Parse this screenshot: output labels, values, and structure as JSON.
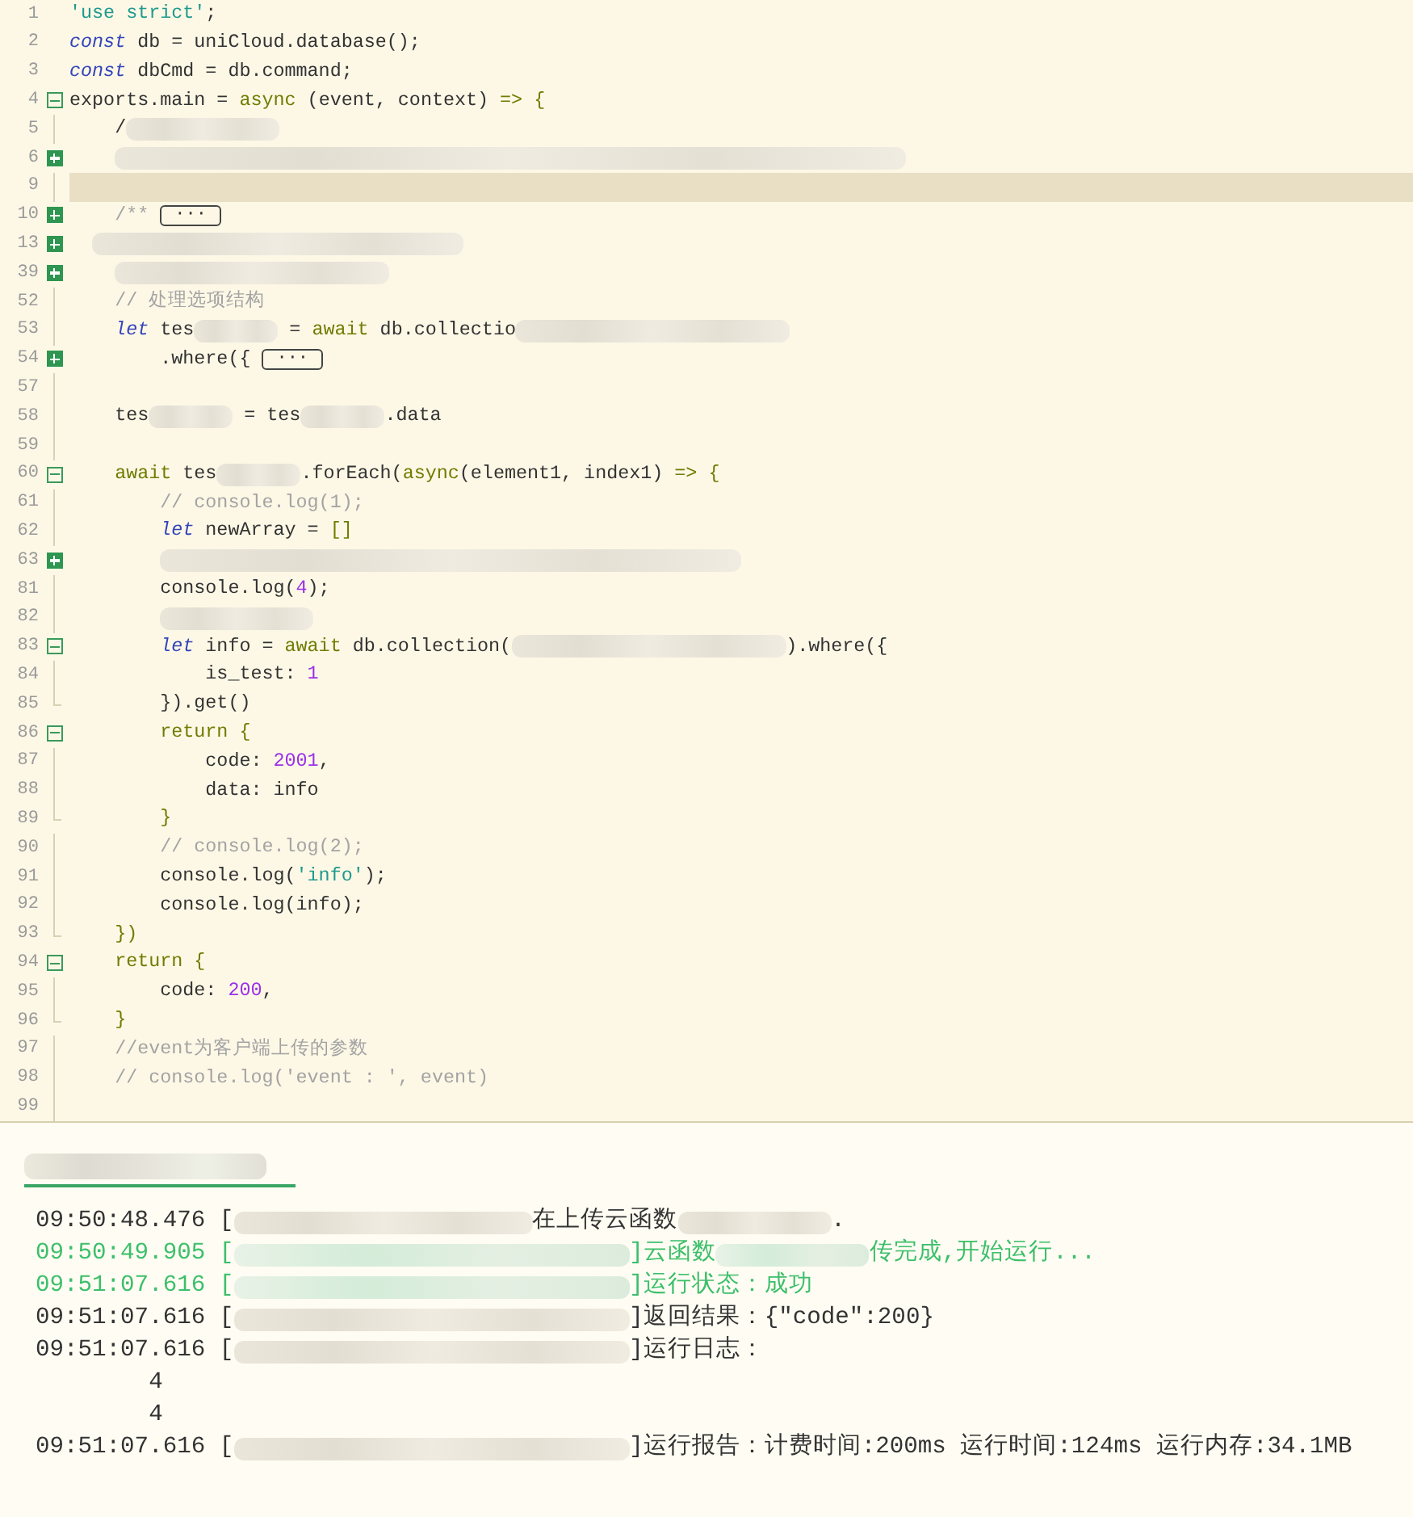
{
  "editor": {
    "lines": [
      {
        "num": "1",
        "kind": "plain",
        "highlighted": false,
        "tokens": [
          {
            "kind": "string",
            "s": "'use strict'"
          },
          {
            "kind": "plain",
            "s": ";"
          }
        ]
      },
      {
        "num": "2",
        "kind": "plain",
        "highlighted": false,
        "tokens": [
          {
            "kind": "keyword",
            "s": "const"
          },
          {
            "kind": "plain",
            "s": " db = uniCloud.database();"
          }
        ]
      },
      {
        "num": "3",
        "kind": "plain",
        "highlighted": false,
        "tokens": [
          {
            "kind": "keyword",
            "s": "const"
          },
          {
            "kind": "plain",
            "s": " dbCmd = db.command;"
          }
        ]
      },
      {
        "num": "4",
        "kind": "open",
        "highlighted": false,
        "tokens": [
          {
            "kind": "plain",
            "s": "exports.main = "
          },
          {
            "kind": "olive",
            "s": "async"
          },
          {
            "kind": "plain",
            "s": " (event, context) "
          },
          {
            "kind": "olive",
            "s": "=> {"
          }
        ]
      },
      {
        "num": "5",
        "kind": "body",
        "highlighted": false,
        "tokens": [
          {
            "kind": "plain",
            "s": "    /"
          },
          {
            "kind": "blurmedium"
          }
        ]
      },
      {
        "num": "6",
        "kind": "closed",
        "highlighted": false,
        "tokens": [
          {
            "kind": "indent"
          },
          {
            "kind": "blurfull"
          }
        ]
      },
      {
        "num": "9",
        "kind": "body",
        "highlighted": true
      },
      {
        "num": "10",
        "kind": "closed",
        "highlighted": false,
        "tokens": [
          {
            "kind": "comment",
            "s": "    /** "
          },
          {
            "kind": "fold",
            "s": "···"
          }
        ]
      },
      {
        "num": "13",
        "kind": "closed",
        "highlighted": false,
        "tokens": [
          {
            "kind": "halfindent"
          },
          {
            "kind": "blurwide"
          }
        ]
      },
      {
        "num": "39",
        "kind": "closed",
        "highlighted": false,
        "tokens": [
          {
            "kind": "indent"
          },
          {
            "kind": "blurlong"
          }
        ]
      },
      {
        "num": "52",
        "kind": "body",
        "highlighted": false,
        "tokens": [
          {
            "kind": "comment",
            "s": "    // 处理选项结构"
          }
        ]
      },
      {
        "num": "53",
        "kind": "body",
        "highlighted": false,
        "tokens": [
          {
            "kind": "keyword",
            "s": "    let"
          },
          {
            "kind": "plain",
            "s": " tes"
          },
          {
            "kind": "blurshort"
          },
          {
            "kind": "plain",
            "s": " = "
          },
          {
            "kind": "olive",
            "s": "await"
          },
          {
            "kind": "plain",
            "s": " db.collectio"
          },
          {
            "kind": "blurlong"
          }
        ]
      },
      {
        "num": "54",
        "kind": "closed",
        "highlighted": false,
        "tokens": [
          {
            "kind": "plain",
            "s": "        .where({ "
          },
          {
            "kind": "fold",
            "s": "···"
          }
        ]
      },
      {
        "num": "57",
        "kind": "body",
        "highlighted": false
      },
      {
        "num": "58",
        "kind": "body",
        "highlighted": false,
        "tokens": [
          {
            "kind": "plain",
            "s": "    tes"
          },
          {
            "kind": "blurshort"
          },
          {
            "kind": "plain",
            "s": " = tes"
          },
          {
            "kind": "blurshort"
          },
          {
            "kind": "plain",
            "s": ".data"
          }
        ]
      },
      {
        "num": "59",
        "kind": "body",
        "highlighted": false
      },
      {
        "num": "60",
        "kind": "open",
        "highlighted": false,
        "tokens": [
          {
            "kind": "olive",
            "s": "    await"
          },
          {
            "kind": "plain",
            "s": " tes"
          },
          {
            "kind": "blurshort"
          },
          {
            "kind": "plain",
            "s": ".forEach("
          },
          {
            "kind": "olive",
            "s": "async"
          },
          {
            "kind": "plain",
            "s": "(element1, index1) "
          },
          {
            "kind": "olive",
            "s": "=> {"
          }
        ]
      },
      {
        "num": "61",
        "kind": "body",
        "highlighted": false,
        "tokens": [
          {
            "kind": "comment",
            "s": "        // console.log(1);"
          }
        ]
      },
      {
        "num": "62",
        "kind": "body",
        "highlighted": false,
        "tokens": [
          {
            "kind": "keyword",
            "s": "        let"
          },
          {
            "kind": "plain",
            "s": " newArray = "
          },
          {
            "kind": "olive",
            "s": "[]"
          }
        ]
      },
      {
        "num": "63",
        "kind": "closed",
        "highlighted": false,
        "tokens": [
          {
            "kind": "indent"
          },
          {
            "kind": "indent"
          },
          {
            "kind": "blurxl"
          }
        ]
      },
      {
        "num": "81",
        "kind": "body",
        "highlighted": false,
        "tokens": [
          {
            "kind": "plain",
            "s": "        console.log("
          },
          {
            "kind": "number",
            "s": "4"
          },
          {
            "kind": "plain",
            "s": ");"
          }
        ]
      },
      {
        "num": "82",
        "kind": "body",
        "highlighted": false,
        "tokens": [
          {
            "kind": "indent"
          },
          {
            "kind": "indent"
          },
          {
            "kind": "blurmedium"
          }
        ]
      },
      {
        "num": "83",
        "kind": "open",
        "highlighted": false,
        "tokens": [
          {
            "kind": "keyword",
            "s": "        let"
          },
          {
            "kind": "plain",
            "s": " info = "
          },
          {
            "kind": "olive",
            "s": "await"
          },
          {
            "kind": "plain",
            "s": " db.collection("
          },
          {
            "kind": "blurlong"
          },
          {
            "kind": "plain",
            "s": ").where({"
          }
        ]
      },
      {
        "num": "84",
        "kind": "body",
        "highlighted": false,
        "tokens": [
          {
            "kind": "plain",
            "s": "            is_test: "
          },
          {
            "kind": "number",
            "s": "1"
          }
        ]
      },
      {
        "num": "85",
        "kind": "end",
        "highlighted": false,
        "tokens": [
          {
            "kind": "plain",
            "s": "        }).get()"
          }
        ]
      },
      {
        "num": "86",
        "kind": "open",
        "highlighted": false,
        "tokens": [
          {
            "kind": "olive",
            "s": "        return {"
          }
        ]
      },
      {
        "num": "87",
        "kind": "body",
        "highlighted": false,
        "tokens": [
          {
            "kind": "plain",
            "s": "            code: "
          },
          {
            "kind": "number",
            "s": "2001"
          },
          {
            "kind": "plain",
            "s": ","
          }
        ]
      },
      {
        "num": "88",
        "kind": "body",
        "highlighted": false,
        "tokens": [
          {
            "kind": "plain",
            "s": "            data: info"
          }
        ]
      },
      {
        "num": "89",
        "kind": "end",
        "highlighted": false,
        "tokens": [
          {
            "kind": "olive",
            "s": "        }"
          }
        ]
      },
      {
        "num": "90",
        "kind": "body",
        "highlighted": false,
        "tokens": [
          {
            "kind": "comment",
            "s": "        // console.log(2);"
          }
        ]
      },
      {
        "num": "91",
        "kind": "body",
        "highlighted": false,
        "tokens": [
          {
            "kind": "plain",
            "s": "        console.log("
          },
          {
            "kind": "string",
            "s": "'info'"
          },
          {
            "kind": "plain",
            "s": ");"
          }
        ]
      },
      {
        "num": "92",
        "kind": "body",
        "highlighted": false,
        "tokens": [
          {
            "kind": "plain",
            "s": "        console.log(info);"
          }
        ]
      },
      {
        "num": "93",
        "kind": "end",
        "highlighted": false,
        "tokens": [
          {
            "kind": "olive",
            "s": "    })"
          }
        ]
      },
      {
        "num": "94",
        "kind": "open",
        "highlighted": false,
        "tokens": [
          {
            "kind": "olive",
            "s": "    return {"
          }
        ]
      },
      {
        "num": "95",
        "kind": "body",
        "highlighted": false,
        "tokens": [
          {
            "kind": "plain",
            "s": "        code: "
          },
          {
            "kind": "number",
            "s": "200"
          },
          {
            "kind": "plain",
            "s": ","
          }
        ]
      },
      {
        "num": "96",
        "kind": "end",
        "highlighted": false,
        "tokens": [
          {
            "kind": "olive",
            "s": "    }"
          }
        ]
      },
      {
        "num": "97",
        "kind": "body",
        "highlighted": false,
        "tokens": [
          {
            "kind": "comment",
            "s": "    //event为客户端上传的参数"
          }
        ]
      },
      {
        "num": "98",
        "kind": "body",
        "highlighted": false,
        "tokens": [
          {
            "kind": "comment",
            "s": "    // console.log('event : ', event)"
          }
        ]
      },
      {
        "num": "99",
        "kind": "body",
        "highlighted": false
      }
    ]
  },
  "console": {
    "tab": {
      "selected": true
    },
    "lines": [
      {
        "success": false,
        "tokens": [
          {
            "kind": "plain",
            "s": "09:50:48.476 ["
          },
          {
            "kind": "blurcmed"
          },
          {
            "kind": "plain",
            "s": "在上传云函数"
          },
          {
            "kind": "blurmedium"
          },
          {
            "kind": "plain",
            "s": "."
          }
        ]
      },
      {
        "success": true,
        "tokens": [
          {
            "kind": "plain",
            "s": "09:50:49.905 ["
          },
          {
            "kind": "blurcwide"
          },
          {
            "kind": "plain",
            "s": "]云函数"
          },
          {
            "kind": "blurmedium"
          },
          {
            "kind": "plain",
            "s": "传完成,开始运行..."
          }
        ]
      },
      {
        "success": true,
        "tokens": [
          {
            "kind": "plain",
            "s": "09:51:07.616 ["
          },
          {
            "kind": "blurcwide"
          },
          {
            "kind": "plain",
            "s": "]运行状态：成功"
          }
        ]
      },
      {
        "success": false,
        "tokens": [
          {
            "kind": "plain",
            "s": "09:51:07.616 ["
          },
          {
            "kind": "blurcwide"
          },
          {
            "kind": "plain",
            "s": "]返回结果：{\"code\":200}"
          }
        ]
      },
      {
        "success": false,
        "tokens": [
          {
            "kind": "plain",
            "s": "09:51:07.616 ["
          },
          {
            "kind": "blurcwide"
          },
          {
            "kind": "plain",
            "s": "]运行日志："
          }
        ]
      },
      {
        "success": false,
        "tokens": [
          {
            "kind": "plain",
            "s": "        4"
          }
        ]
      },
      {
        "success": false,
        "tokens": [
          {
            "kind": "plain",
            "s": "        4"
          }
        ]
      },
      {
        "success": false,
        "tokens": [
          {
            "kind": "plain",
            "s": "09:51:07.616 ["
          },
          {
            "kind": "blurcwide"
          },
          {
            "kind": "plain",
            "s": "]运行报告：计费时间:200ms 运行时间:124ms 运行内存:34.1MB"
          }
        ]
      }
    ]
  }
}
